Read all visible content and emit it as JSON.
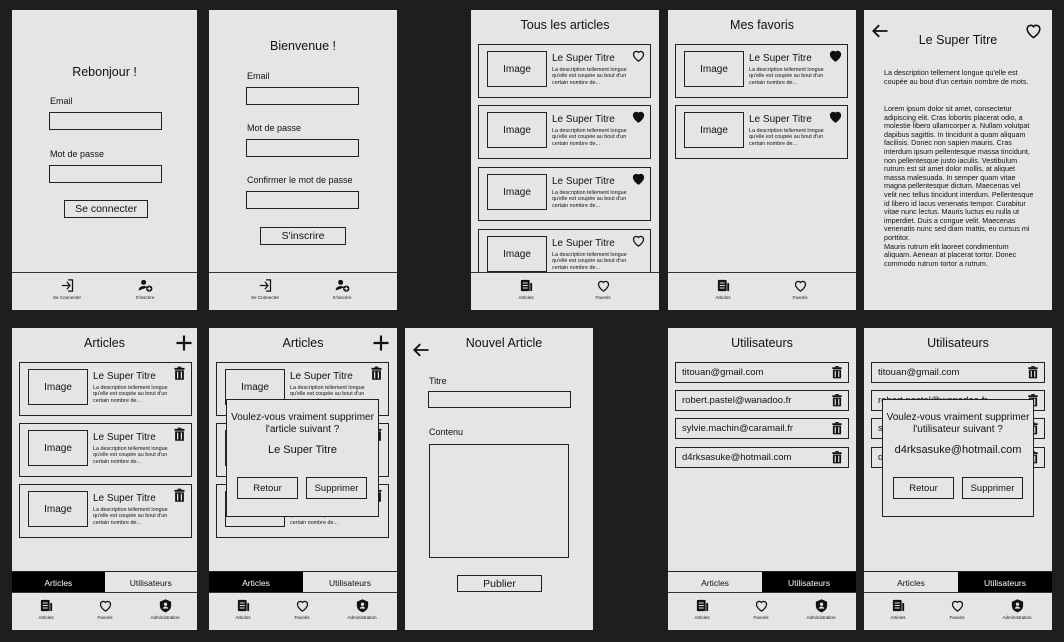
{
  "login": {
    "greeting": "Rebonjour !",
    "email_label": "Email",
    "password_label": "Mot de passe",
    "submit": "Se connecter"
  },
  "register": {
    "greeting": "Bienvenue !",
    "email_label": "Email",
    "password_label": "Mot de passe",
    "confirm_label": "Confirmer le mot de passe",
    "submit": "S'inscrire"
  },
  "auth_nav": {
    "login": "Se Connecter",
    "register": "S'inscrire"
  },
  "card": {
    "image": "Image",
    "title": "Le Super Titre",
    "desc": "La description tellement longue qu'elle est coupée au bout d'un certain nombre de..."
  },
  "all_articles": {
    "title": "Tous les articles"
  },
  "favorites": {
    "title": "Mes favoris"
  },
  "user_nav": {
    "articles": "Articles",
    "favorites": "Favoris"
  },
  "detail": {
    "title": "Le Super Titre",
    "intro": "La description tellement longue qu'elle est coupée au bout d'un certain nombre de mots.",
    "body": "Lorem ipsum dolor sit amet, consectetur adipiscing elit. Cras lobortis placerat odio, a molestie libero ullamcorper a. Nullam volutpat dapibus sagittis. In tincidunt a quam aliquam facilisis. Donec non sapien mauris. Cras interdum ipsum pellentesque massa tincidunt, non pellentesque justo iaculis. Vestibulum rutrum est sit amet dolor mollis, at aliquet massa malesuada. In semper quam vitae magna pellentesque dictum. Maecenas vel velit nec tellus tincidunt interdum. Pellentesque id libero id lacus venenatis tempor. Curabitur vitae nunc lectus. Mauris luctus eu nulla ut imperdiet. Duis a congue velit. Maecenas venenatis nunc sed diam mattis, eu cursus mi porttitor.\nMauris rutrum elit laoreet condimentum aliquam. Aenean at placerat tortor. Donec commodo rutrum tortor a rutrum."
  },
  "admin_articles": {
    "title": "Articles"
  },
  "admin_tabs": {
    "articles": "Articles",
    "users": "Utilisateurs"
  },
  "admin_nav": {
    "articles": "Articles",
    "favorites": "Favoris",
    "admin": "Administration"
  },
  "delete_article_modal": {
    "question": "Voulez-vous vraiment supprimer l'article suivant ?",
    "target": "Le Super Titre",
    "back": "Retour",
    "confirm": "Supprimer"
  },
  "new_article": {
    "title": "Nouvel Article",
    "title_label": "Titre",
    "content_label": "Contenu",
    "submit": "Publier"
  },
  "users": {
    "title": "Utilisateurs",
    "list": [
      "titouan@gmail.com",
      "robert.pastel@wanadoo.fr",
      "sylvie.machin@caramail.fr",
      "d4rksasuke@hotmail.com"
    ]
  },
  "delete_user_modal": {
    "question": "Voulez-vous vraiment supprimer l'utilisateur suivant ?",
    "target": "d4rksasuke@hotmail.com",
    "back": "Retour",
    "confirm": "Supprimer"
  }
}
